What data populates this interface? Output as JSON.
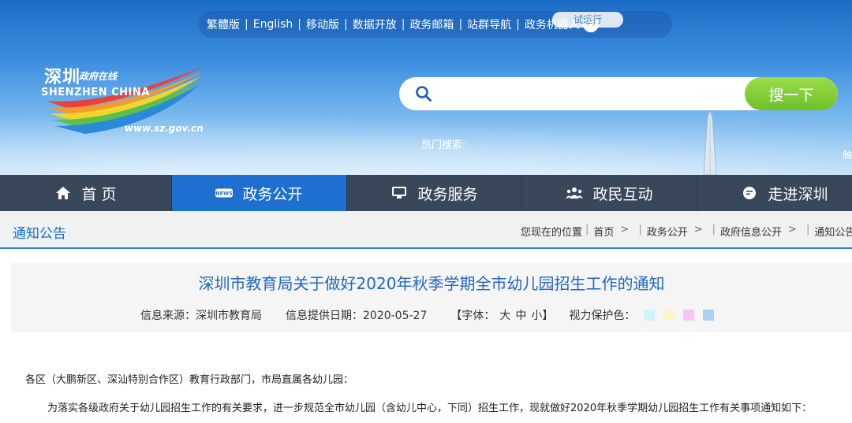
{
  "toplinks": [
    "繁體版",
    "English",
    "移动版",
    "数据开放",
    "政务邮箱",
    "站群导航",
    "政务机器人"
  ],
  "trial_badge": "试运行",
  "logo": {
    "cn_title": "深圳",
    "cn_sub": "政府在线",
    "en": "SHENZHEN CHINA",
    "url": "www.sz.gov.cn"
  },
  "search": {
    "button": "搜一下",
    "value": ""
  },
  "hot_search_label": "热门搜索:",
  "edge_label": "触",
  "nav": [
    {
      "label": "首 页",
      "icon": "home-icon"
    },
    {
      "label": "政务公开",
      "icon": "news-icon",
      "active": true
    },
    {
      "label": "政务服务",
      "icon": "monitor-icon"
    },
    {
      "label": "政民互动",
      "icon": "people-icon"
    },
    {
      "label": "走进深圳",
      "icon": "chat-icon"
    }
  ],
  "section_title": "通知公告",
  "breadcrumb": {
    "label": "您现在的位置",
    "items": [
      "首页",
      "政务公开",
      "政府信息公开",
      "通知公告"
    ]
  },
  "article": {
    "title": "深圳市教育局关于做好2020年秋季学期全市幼儿园招生工作的通知",
    "source": "信息来源：深圳市教育局",
    "date": "信息提供日期：2020-05-27",
    "font_open": "【字体：",
    "font_sizes": [
      "大",
      "中",
      "小"
    ],
    "font_close": "】",
    "eye_care_label": "视力保护色：",
    "eye_care_colors": [
      "#cdf3fb",
      "#fbf7c4",
      "#fcc4f6",
      "#a8d2f7"
    ]
  },
  "body": {
    "salutation": "各区（大鹏新区、深汕特别合作区）教育行政部门，市局直属各幼儿园：",
    "para1": "为落实各级政府关于幼儿园招生工作的有关要求，进一步规范全市幼儿园（含幼儿中心，下同）招生工作，现就做好2020年秋季学期幼儿园招生工作有关事项通知如下："
  }
}
